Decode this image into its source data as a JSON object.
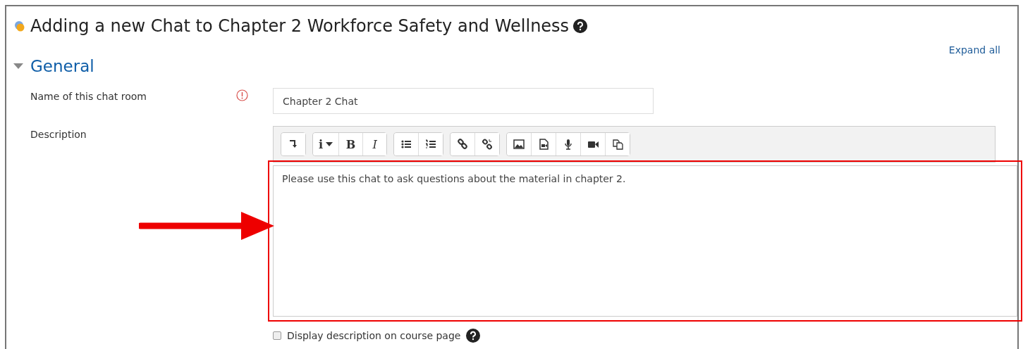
{
  "title": "Adding a new Chat to Chapter 2 Workforce Safety and Wellness",
  "expand_all": "Expand all",
  "section": {
    "title": "General",
    "expanded": true
  },
  "name_field": {
    "label": "Name of this chat room",
    "required": true,
    "value": "Chapter 2 Chat"
  },
  "description": {
    "label": "Description",
    "value": "Please use this chat to ask questions about the material in chapter 2.",
    "highlighted": true,
    "toolbar": [
      [
        {
          "kind": "collapse"
        }
      ],
      [
        {
          "kind": "info",
          "glyph": "i"
        },
        {
          "kind": "bold",
          "glyph": "B"
        },
        {
          "kind": "italic",
          "glyph": "I"
        }
      ],
      [
        {
          "kind": "bullets"
        },
        {
          "kind": "numbers"
        }
      ],
      [
        {
          "kind": "link"
        },
        {
          "kind": "unlink"
        }
      ],
      [
        {
          "kind": "image"
        },
        {
          "kind": "media"
        },
        {
          "kind": "mic"
        },
        {
          "kind": "video"
        },
        {
          "kind": "copy"
        }
      ]
    ]
  },
  "display_on_course_page": {
    "label": "Display description on course page",
    "checked": false
  }
}
